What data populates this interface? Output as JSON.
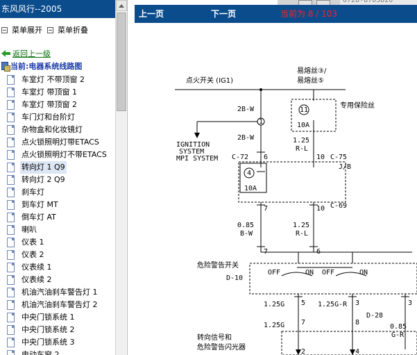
{
  "left": {
    "title": "东风风行--2005",
    "toolbar": {
      "expand": "菜单展开",
      "collapse": "菜单折叠"
    },
    "back": "返回上一级",
    "current": "当前:电器系统线路图",
    "items": [
      "车室灯 不带顶窗 2",
      "车室灯 带顶窗 1",
      "车室灯 带顶窗 2",
      "车门灯和台阶灯",
      "杂物盒和化妆镜灯",
      "点火锁照明灯带ETACS",
      "点火锁照明灯不带ETACS",
      "转向灯 1 Q9",
      "转向灯 2 Q9",
      "刹车灯",
      "到车灯 MT",
      "倒车灯 AT",
      "喇叭",
      "仪表 1",
      "仪表 2",
      "仪表续 1",
      "仪表续 2",
      "机油汽油刹车警告灯 1",
      "机油汽油刹车警告灯 2",
      "中央门锁系统 1",
      "中央门锁系统 2",
      "中央门锁系统 3",
      "电动车窗 2"
    ],
    "selected_index": 7
  },
  "right": {
    "prev": "上一页",
    "next": "下一页",
    "page": "当前为 8 / 103",
    "phone_fragment": "0728-8703820"
  },
  "diagram": {
    "ig1": "点火开关 (IG1)",
    "fuse_label_1": "易熔丝③/",
    "fuse_label_2": "易熔丝⑤",
    "dedicated_fuse": "专用保险丝",
    "w1": "2B-W",
    "w2": "2B-W",
    "ign1": "IGNITION",
    "ign2": "SYSTEM",
    "ign3": "MPI SYSTEM",
    "c72": "C-72",
    "c75": "C-75",
    "c69": "C-69",
    "d10": "D-10",
    "d28": "D-28",
    "jb": "J/B",
    "f4": "4",
    "f4a": "10A",
    "f11": "11",
    "f11a": "10A",
    "w125rl": "1.25",
    "w125rl2": "R-L",
    "w085": "0.85",
    "w085b": "B-W",
    "w125b": "1.25",
    "w125b2": "R-L",
    "hazard": "危险警告开关",
    "off1": "OFF",
    "on1": "ON",
    "off2": "OFF",
    "on2": "ON",
    "g125a": "1.25G",
    "g125b": "1.25G-R",
    "g125c": "1.25G",
    "g085": "0.85",
    "g085b": "G-R",
    "flasher1": "转向信号和",
    "flasher2": "危险警告闪光器",
    "pins": [
      "1",
      "6",
      "10",
      "7",
      "10",
      "7",
      "6",
      "5",
      "3",
      "7",
      "8",
      "2",
      "4",
      "3"
    ]
  }
}
